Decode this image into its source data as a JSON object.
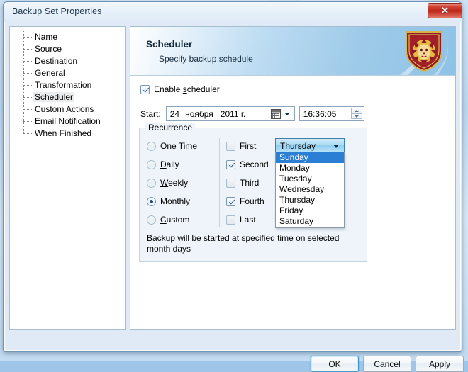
{
  "window": {
    "title": "Backup Set Properties",
    "close_icon": "close-icon",
    "close_glyph": "✕"
  },
  "sidebar": {
    "items": [
      {
        "label": "Name",
        "selected": false
      },
      {
        "label": "Source",
        "selected": false
      },
      {
        "label": "Destination",
        "selected": false
      },
      {
        "label": "General",
        "selected": false
      },
      {
        "label": "Transformation",
        "selected": false
      },
      {
        "label": "Scheduler",
        "selected": true
      },
      {
        "label": "Custom Actions",
        "selected": false
      },
      {
        "label": "Email Notification",
        "selected": false
      },
      {
        "label": "When Finished",
        "selected": false
      }
    ]
  },
  "banner": {
    "title": "Scheduler",
    "subtitle": "Specify backup schedule",
    "logo_icon": "lion-shield-logo-icon"
  },
  "scheduler": {
    "enable": {
      "label": "Enable scheduler",
      "accel": "s",
      "checked": true
    },
    "start": {
      "label": "Start:",
      "accel": "t",
      "date": {
        "day": "24",
        "month": "ноября",
        "year": "2011 г.",
        "calendar_icon": "calendar-icon"
      },
      "time": {
        "value": "16:36:05"
      }
    },
    "recurrence": {
      "legend": "Recurrence",
      "radios": [
        {
          "label": "One Time",
          "accel": "O",
          "selected": false
        },
        {
          "label": "Daily",
          "accel": "D",
          "selected": false
        },
        {
          "label": "Weekly",
          "accel": "W",
          "selected": false
        },
        {
          "label": "Monthly",
          "accel": "M",
          "selected": true
        },
        {
          "label": "Custom",
          "accel": "C",
          "selected": false
        }
      ],
      "ordinals": [
        {
          "label": "First",
          "checked": false
        },
        {
          "label": "Second",
          "checked": true
        },
        {
          "label": "Third",
          "checked": false
        },
        {
          "label": "Fourth",
          "checked": true
        },
        {
          "label": "Last",
          "checked": false
        }
      ],
      "weekday_combo": {
        "value": "Thursday",
        "expanded": true,
        "highlighted": "Sunday",
        "options": [
          "Sunday",
          "Monday",
          "Tuesday",
          "Wednesday",
          "Thursday",
          "Friday",
          "Saturday"
        ]
      },
      "description": "Backup will be started at specified time on selected month days"
    }
  },
  "footer": {
    "ok": "OK",
    "cancel": "Cancel",
    "apply": "Apply"
  },
  "colors": {
    "accent": "#2a7fd4",
    "dialog_bg": "#dfeaf6",
    "banner_blue": "#8fc2e5",
    "close_red": "#bb2718",
    "logo_gold": "#e0b13a",
    "logo_dark_red": "#8e1b20"
  }
}
